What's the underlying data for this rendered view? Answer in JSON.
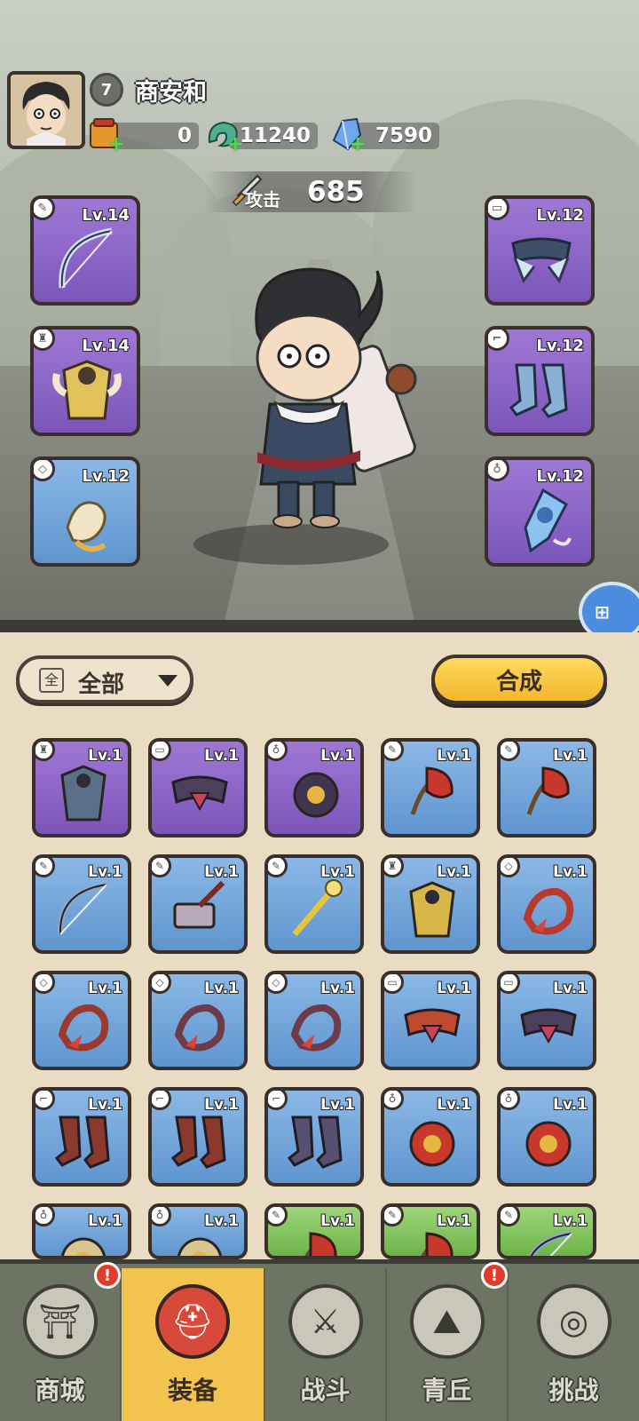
{
  "player": {
    "level": "7",
    "name": "商安和"
  },
  "resources": [
    {
      "icon": "scroll-bag-icon",
      "value": "0"
    },
    {
      "icon": "jade-dragon-icon",
      "value": "11240"
    },
    {
      "icon": "blue-crystal-icon",
      "value": "7590"
    }
  ],
  "attack": {
    "label": "攻击",
    "value": "685"
  },
  "equipped_left": [
    {
      "slot": "weapon",
      "icon": "bow-icon",
      "level": "Lv.14",
      "rarity": "purple"
    },
    {
      "slot": "armor",
      "icon": "armor-icon",
      "level": "Lv.14",
      "rarity": "purple"
    },
    {
      "slot": "ring",
      "icon": "ring-icon",
      "level": "Lv.12",
      "rarity": "blue"
    }
  ],
  "equipped_right": [
    {
      "slot": "belt",
      "icon": "belt-icon",
      "level": "Lv.12",
      "rarity": "purple"
    },
    {
      "slot": "boots",
      "icon": "boots-icon",
      "level": "Lv.12",
      "rarity": "purple"
    },
    {
      "slot": "amulet",
      "icon": "amulet-icon",
      "level": "Lv.12",
      "rarity": "purple"
    }
  ],
  "side_button": {
    "icon": "gamepad-icon"
  },
  "filter": {
    "box_char": "全",
    "label": "全部"
  },
  "synthesize_label": "合成",
  "inventory": [
    {
      "icon": "armor-icon",
      "level": "Lv.1",
      "rarity": "purple",
      "color": "#5b6f8a"
    },
    {
      "icon": "belt-icon",
      "level": "Lv.1",
      "rarity": "purple",
      "color": "#4b3f5c"
    },
    {
      "icon": "amulet-icon",
      "level": "Lv.1",
      "rarity": "purple",
      "color": "#3f3550"
    },
    {
      "icon": "slingshot-icon",
      "level": "Lv.1",
      "rarity": "blue",
      "color": "#c8382d"
    },
    {
      "icon": "slingshot-icon",
      "level": "Lv.1",
      "rarity": "blue",
      "color": "#c8382d"
    },
    {
      "icon": "bow-icon",
      "level": "Lv.1",
      "rarity": "blue",
      "color": "#8fa9c4"
    },
    {
      "icon": "hammer-icon",
      "level": "Lv.1",
      "rarity": "blue",
      "color": "#b8aab8"
    },
    {
      "icon": "staff-icon",
      "level": "Lv.1",
      "rarity": "blue",
      "color": "#e4c53c"
    },
    {
      "icon": "armor-icon",
      "level": "Lv.1",
      "rarity": "blue",
      "color": "#d8b74a"
    },
    {
      "icon": "ring-icon",
      "level": "Lv.1",
      "rarity": "blue",
      "color": "#b8392e"
    },
    {
      "icon": "ring-icon",
      "level": "Lv.1",
      "rarity": "blue",
      "color": "#9a3a2e"
    },
    {
      "icon": "ring-icon",
      "level": "Lv.1",
      "rarity": "blue",
      "color": "#6e3b4a"
    },
    {
      "icon": "ring-icon",
      "level": "Lv.1",
      "rarity": "blue",
      "color": "#6e3b4a"
    },
    {
      "icon": "belt-icon",
      "level": "Lv.1",
      "rarity": "blue",
      "color": "#c04a2f"
    },
    {
      "icon": "belt-icon",
      "level": "Lv.1",
      "rarity": "blue",
      "color": "#4b3f5c"
    },
    {
      "icon": "boots-icon",
      "level": "Lv.1",
      "rarity": "blue",
      "color": "#8a3a2c"
    },
    {
      "icon": "boots-icon",
      "level": "Lv.1",
      "rarity": "blue",
      "color": "#8a3a2c"
    },
    {
      "icon": "boots-icon",
      "level": "Lv.1",
      "rarity": "blue",
      "color": "#57506e"
    },
    {
      "icon": "amulet-icon",
      "level": "Lv.1",
      "rarity": "blue",
      "color": "#c8382d"
    },
    {
      "icon": "amulet-icon",
      "level": "Lv.1",
      "rarity": "blue",
      "color": "#c8382d"
    },
    {
      "icon": "amulet-icon",
      "level": "Lv.1",
      "rarity": "blue",
      "color": "#d8c690"
    },
    {
      "icon": "amulet-icon",
      "level": "Lv.1",
      "rarity": "blue",
      "color": "#d8c690"
    },
    {
      "icon": "slingshot-icon",
      "level": "Lv.1",
      "rarity": "green",
      "color": "#c8382d"
    },
    {
      "icon": "slingshot-icon",
      "level": "Lv.1",
      "rarity": "green",
      "color": "#c8382d"
    },
    {
      "icon": "bow-icon",
      "level": "Lv.1",
      "rarity": "green",
      "color": "#8fa9c4"
    }
  ],
  "nav": [
    {
      "label": "商城",
      "icon": "shop-icon",
      "glyph": "⛩",
      "alert": true,
      "active": false
    },
    {
      "label": "装备",
      "icon": "helmet-icon",
      "glyph": "⛑",
      "alert": false,
      "active": true
    },
    {
      "label": "战斗",
      "icon": "crossed-swords-icon",
      "glyph": "⚔",
      "alert": false,
      "active": false
    },
    {
      "label": "青丘",
      "icon": "mountain-icon",
      "glyph": "⛰",
      "alert": true,
      "active": false
    },
    {
      "label": "挑战",
      "icon": "drum-icon",
      "glyph": "◎",
      "alert": false,
      "active": false
    }
  ],
  "colors": {
    "purple_frame": "#8a63c6",
    "blue_frame": "#6fa3da",
    "green_frame": "#7cc257",
    "synth_button": "#f5c23c",
    "nav_active": "#f2c34f"
  }
}
